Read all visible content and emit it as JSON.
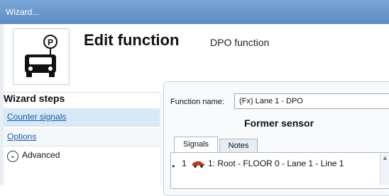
{
  "window": {
    "title": "Wizard..."
  },
  "header": {
    "title": "Edit function",
    "subtitle": "DPO function",
    "icon": "parking-car-icon"
  },
  "sidebar": {
    "heading": "Wizard steps",
    "items": [
      {
        "label": "Counter signals"
      },
      {
        "label": "Options"
      },
      {
        "label": "Advanced",
        "icon": "chevron-circle-down-icon"
      }
    ]
  },
  "main": {
    "function_name_label": "Function name:",
    "function_name_value": "(Fx) Lane 1 - DPO",
    "group_title": "Former sensor",
    "tabs": [
      {
        "label": "Signals"
      },
      {
        "label": "Notes"
      }
    ],
    "rows": [
      {
        "index": "1",
        "icon": "car-icon",
        "text": "1: Root - FLOOR 0 - Lane 1 - Line 1"
      }
    ]
  },
  "colors": {
    "titlebar": "#6b99cd",
    "link": "#1a5aa8",
    "selected_step": "#d7e8f7",
    "car": "#c0392b"
  }
}
